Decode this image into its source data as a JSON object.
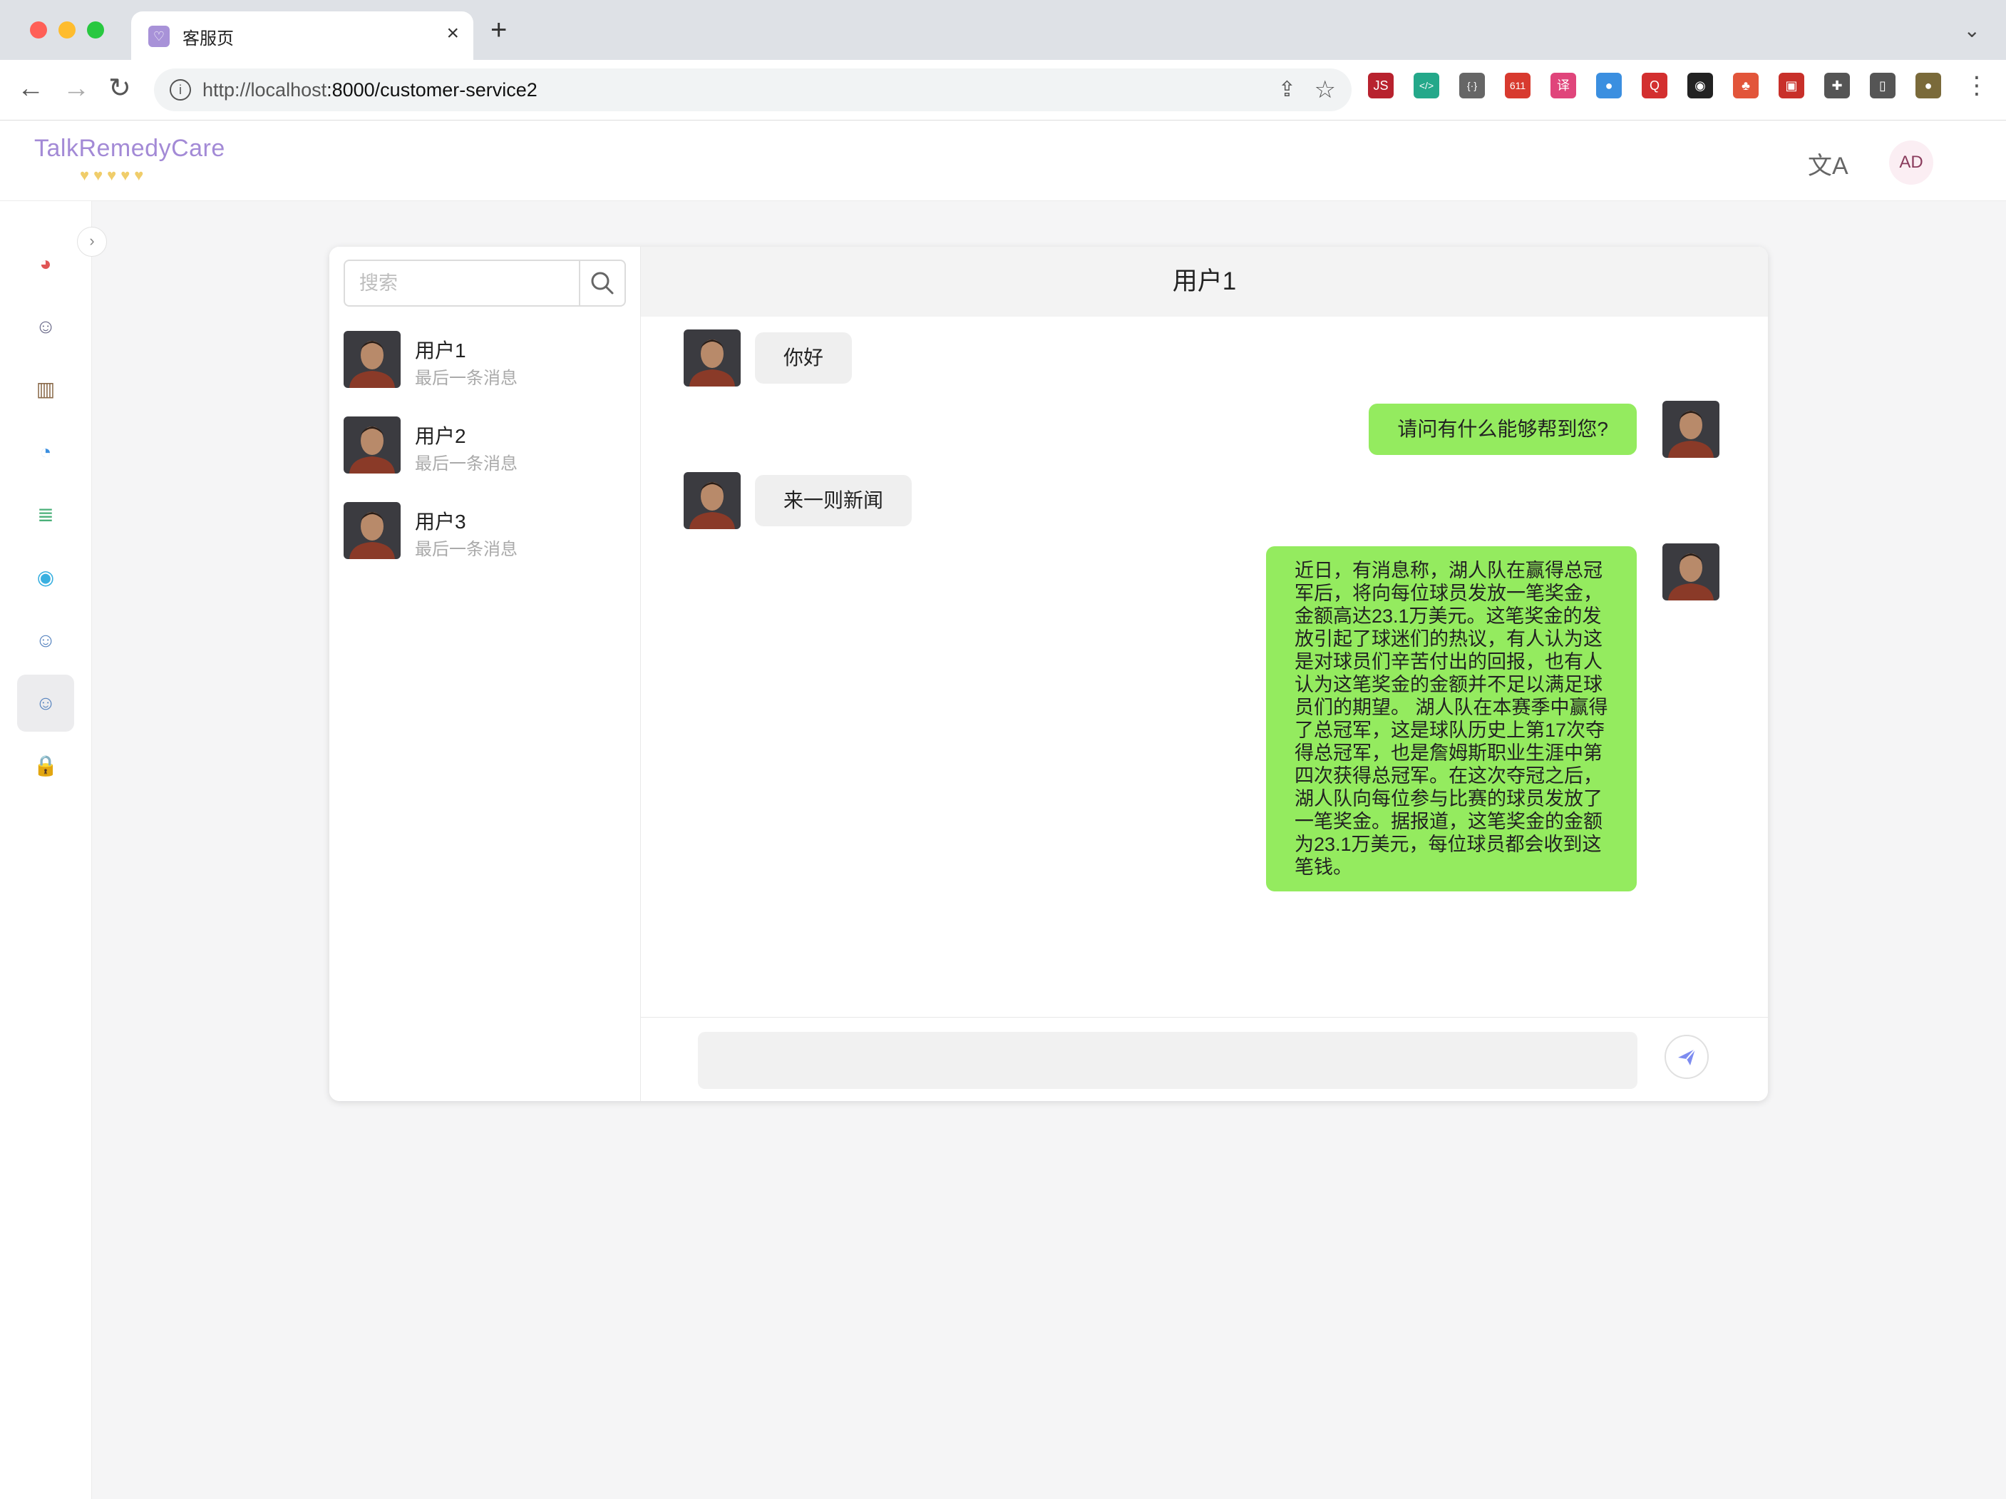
{
  "browser": {
    "tab_title": "客服页",
    "tab_favicon_glyph": "♡",
    "url_host": "http://localhost",
    "url_rest": ":8000/customer-service2",
    "extensions": [
      {
        "name": "js-ext-icon",
        "glyph": "JS",
        "color": "#b8222e"
      },
      {
        "name": "code-ext-icon",
        "glyph": "</>",
        "color": "#24a88a"
      },
      {
        "name": "brackets-ext-icon",
        "glyph": "{·}",
        "color": "#666666"
      },
      {
        "name": "mail-ext-icon",
        "glyph": "611",
        "color": "#d83a2f"
      },
      {
        "name": "translate-ext-icon",
        "glyph": "译",
        "color": "#e0457b"
      },
      {
        "name": "colorful-ext-icon",
        "glyph": "●",
        "color": "#3b8fe0"
      },
      {
        "name": "search-ext-icon",
        "glyph": "Q",
        "color": "#d32f2f"
      },
      {
        "name": "glasses-ext-icon",
        "glyph": "◉",
        "color": "#222222"
      },
      {
        "name": "tree-ext-icon",
        "glyph": "♣",
        "color": "#e2553a"
      },
      {
        "name": "photo-ext-icon",
        "glyph": "▣",
        "color": "#c8302a"
      },
      {
        "name": "puzzle-ext-icon",
        "glyph": "✚",
        "color": "#555555"
      },
      {
        "name": "sidepanel-ext-icon",
        "glyph": "▯",
        "color": "#555555"
      },
      {
        "name": "profile-ext-icon",
        "glyph": "●",
        "color": "#7a6a3a"
      }
    ]
  },
  "header": {
    "logo_text": "TalkRemedyCare",
    "logo_hearts": "♥♥♥♥♥",
    "translate_glyph": "文A",
    "avatar_initials": "AD"
  },
  "sidebar": {
    "items": [
      {
        "name": "sidebar-item-service",
        "glyph": "◕",
        "color": "#e05555"
      },
      {
        "name": "sidebar-item-doctor",
        "glyph": "☺",
        "color": "#6b6b8a"
      },
      {
        "name": "sidebar-item-hospital",
        "glyph": "▥",
        "color": "#8a6a4a"
      },
      {
        "name": "sidebar-item-chat",
        "glyph": "◔",
        "color": "#3b8fe0"
      },
      {
        "name": "sidebar-item-list",
        "glyph": "≣",
        "color": "#4bb07a"
      },
      {
        "name": "sidebar-item-feed",
        "glyph": "◉",
        "color": "#3ab0e0"
      },
      {
        "name": "sidebar-item-staff",
        "glyph": "☺",
        "color": "#5a86c0"
      },
      {
        "name": "sidebar-item-customer-service",
        "glyph": "☺",
        "color": "#5a86c0"
      },
      {
        "name": "sidebar-item-lock",
        "glyph": "🔒",
        "color": "#3b8fe0"
      }
    ],
    "toggle_glyph": "›"
  },
  "search": {
    "placeholder": "搜索"
  },
  "conversations": [
    {
      "name": "用户1",
      "last": "最后一条消息"
    },
    {
      "name": "用户2",
      "last": "最后一条消息"
    },
    {
      "name": "用户3",
      "last": "最后一条消息"
    }
  ],
  "chat": {
    "title": "用户1",
    "messages": [
      {
        "dir": "in",
        "text": "你好"
      },
      {
        "dir": "out",
        "text": "请问有什么能够帮到您?"
      },
      {
        "dir": "in",
        "text": "来一则新闻"
      },
      {
        "dir": "out",
        "text": "近日，有消息称，湖人队在赢得总冠军后，将向每位球员发放一笔奖金，金额高达23.1万美元。这笔奖金的发放引起了球迷们的热议，有人认为这是对球员们辛苦付出的回报，也有人认为这笔奖金的金额并不足以满足球员们的期望。 湖人队在本赛季中赢得了总冠军，这是球队历史上第17次夺得总冠军，也是詹姆斯职业生涯中第四次获得总冠军。在这次夺冠之后，湖人队向每位参与比赛的球员发放了一笔奖金。据报道，这笔奖金的金额为23.1万美元，每位球员都会收到这笔钱。"
      }
    ],
    "input_value": ""
  },
  "colors": {
    "outgoing_bubble": "#94eb5f",
    "incoming_bubble": "#efefef",
    "logo": "#a38ad6"
  }
}
